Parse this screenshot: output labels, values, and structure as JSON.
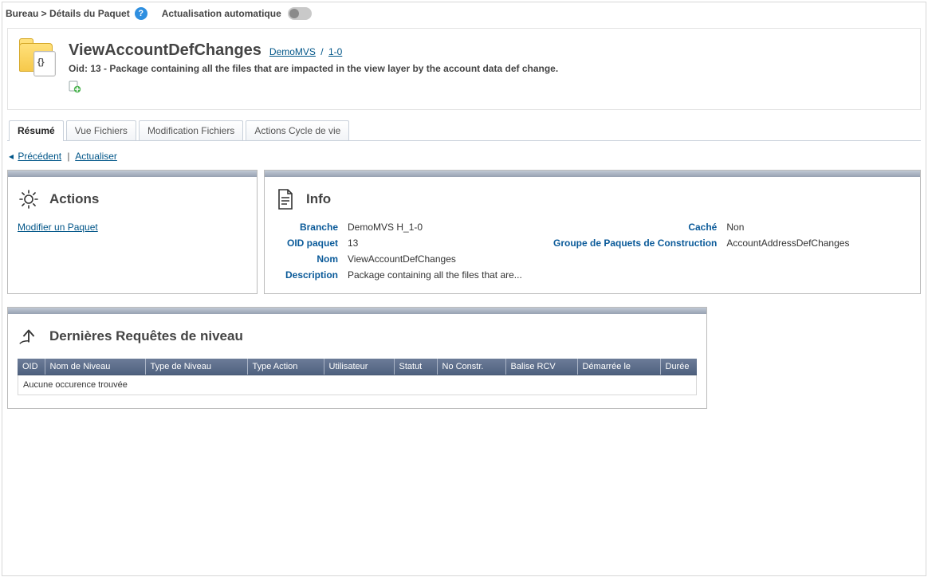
{
  "breadcrumb": "Bureau > Détails du Paquet",
  "autoRefreshLabel": "Actualisation automatique",
  "header": {
    "title": "ViewAccountDefChanges",
    "link1": "DemoMVS",
    "link2": "1-0",
    "subtitle": "Oid: 13 - Package containing all the files that are impacted in the view layer by the account data def change."
  },
  "tabs": {
    "t0": "Résumé",
    "t1": "Vue Fichiers",
    "t2": "Modification Fichiers",
    "t3": "Actions Cycle de vie"
  },
  "nav": {
    "prev": "Précédent",
    "refresh": "Actualiser"
  },
  "actionsPanel": {
    "title": "Actions",
    "modifyLink": "Modifier un Paquet"
  },
  "infoPanel": {
    "title": "Info",
    "labels": {
      "branch": "Branche",
      "oid": "OID paquet",
      "name": "Nom",
      "desc": "Description",
      "hidden": "Caché",
      "buildGroup": "Groupe de Paquets de Construction"
    },
    "values": {
      "branch": "DemoMVS H_1-0",
      "oid": "13",
      "name": "ViewAccountDefChanges",
      "desc": "Package containing all the files that are...",
      "hidden": "Non",
      "buildGroup": "AccountAddressDefChanges"
    }
  },
  "requestsPanel": {
    "title": "Dernières Requêtes de niveau",
    "cols": {
      "c0": "OID",
      "c1": "Nom de Niveau",
      "c2": "Type de Niveau",
      "c3": "Type Action",
      "c4": "Utilisateur",
      "c5": "Statut",
      "c6": "No Constr.",
      "c7": "Balise RCV",
      "c8": "Démarrée le",
      "c9": "Durée"
    },
    "empty": "Aucune occurence trouvée"
  }
}
